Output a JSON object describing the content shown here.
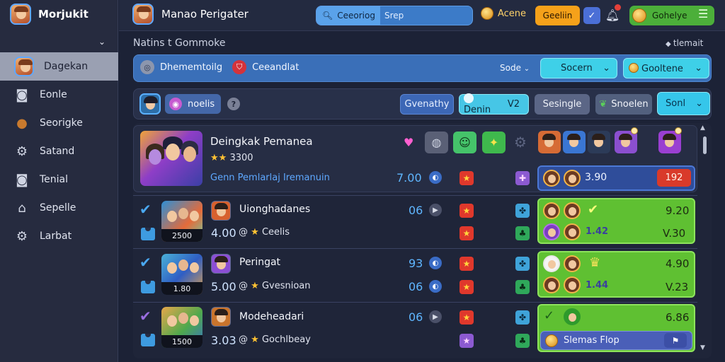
{
  "app": {
    "brand_name": "Morjukit",
    "title": "Manao Perigater"
  },
  "sidebar": {
    "items": [
      {
        "label": "Dagekan",
        "icon": "avatar",
        "active": true
      },
      {
        "label": "Eonle",
        "icon": "camera-icon"
      },
      {
        "label": "Seorigke",
        "icon": "cookie-icon"
      },
      {
        "label": "Satand",
        "icon": "gear-icon"
      },
      {
        "label": "Tenial",
        "icon": "camera-icon"
      },
      {
        "label": "Sepelle",
        "icon": "home-icon"
      },
      {
        "label": "Larbat",
        "icon": "gear-icon"
      }
    ]
  },
  "topbar": {
    "search_mode": "Ceeoriog",
    "search_placeholder": "Srep",
    "coins_label": "Acene",
    "create_label": "Geeliin",
    "profile_label": "Gohelye"
  },
  "notifications": {
    "title": "Natins t Gommoke",
    "right_label": "tlemait"
  },
  "filter_bar": {
    "item1": "Dhememtoilg",
    "item2": "Ceeandlat",
    "status": "Sode",
    "select1": "Socern",
    "select2": "Gooltene"
  },
  "toolbar": {
    "chip_label": "noelis",
    "btn1": "Gvenathy",
    "btn2_label": "Denin",
    "btn2_value": "V2",
    "btn3": "Sesingle",
    "btn4": "Snoelen",
    "btn5": "Sonl"
  },
  "rows": [
    {
      "title": "Deingkak Pemanea",
      "rating": "3300",
      "subtitle": "Genn Pemlarlaj Iremanuin",
      "value": "7.00",
      "panel_value": "3.90",
      "panel_badge": "192"
    },
    {
      "title": "Uionghadanes",
      "thumb_label": "2500",
      "score": "06",
      "rating_value": "4.00",
      "tag": "Ceelis",
      "panel_top": "9.20",
      "panel_mid": "1.42",
      "panel_bottom": "V.30"
    },
    {
      "title": "Peringat",
      "thumb_label": "1.80",
      "score_top": "93",
      "score": "06",
      "rating_value": "5.00",
      "tag": "Gvesnioan",
      "panel_top": "4.90",
      "panel_mid": "1.44",
      "panel_bottom": "V.23"
    },
    {
      "title": "Modeheadari",
      "thumb_label": "1500",
      "score": "06",
      "rating_value": "3.03",
      "tag": "Gochlbeay",
      "panel_top": "6.86",
      "panel_action": "Slemas Flop"
    }
  ]
}
